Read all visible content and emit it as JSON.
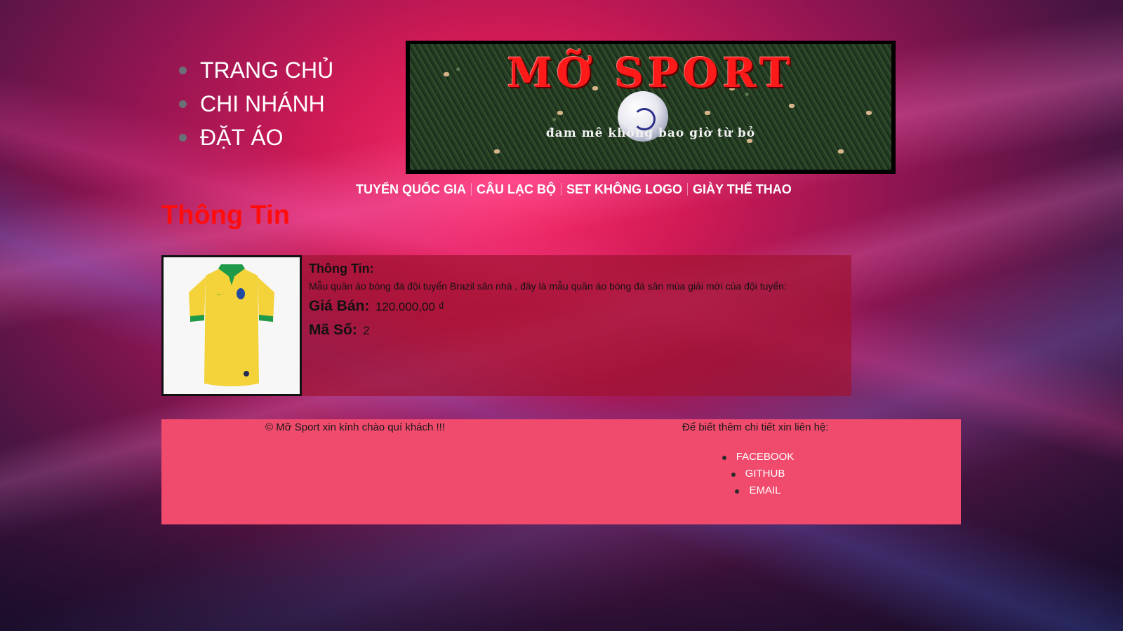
{
  "side_menu": {
    "items": [
      {
        "label": "TRANG CHỦ"
      },
      {
        "label": "CHI NHÁNH"
      },
      {
        "label": "ĐẶT ÁO"
      }
    ]
  },
  "banner": {
    "brand": "MỠ SPORT",
    "slogan": "đam mê không bao giờ từ bỏ"
  },
  "top_nav": {
    "items": [
      {
        "label": "TUYỂN QUỐC GIA"
      },
      {
        "label": "CÂU LẠC BỘ"
      },
      {
        "label": "SET KHÔNG LOGO"
      },
      {
        "label": "GIÀY THỂ THAO"
      }
    ]
  },
  "section": {
    "title": "Thông Tin"
  },
  "product": {
    "info_heading": "Thông Tin:",
    "description": "Mẫu quần áo bóng đá đội tuyển Brazil sân nhà , đây là mẫu quần áo bóng đá sân mùa giải mới của đội tuyển:",
    "price_label": "Giá Bán:",
    "price_value": "120.000,00 ₫",
    "code_label": "Mã Số:",
    "code_value": "2",
    "colors": {
      "shirt": "#f3d23a",
      "collar": "#1f9a4a"
    }
  },
  "footer": {
    "copyright": "© Mỡ Sport xin kính chào quí khách !!!",
    "contact_title": "Để biết thêm chi tiết xin liên hệ:",
    "links": [
      {
        "label": "FACEBOOK"
      },
      {
        "label": "GITHUB"
      },
      {
        "label": "EMAIL"
      }
    ],
    "background": "#f04a6c"
  }
}
